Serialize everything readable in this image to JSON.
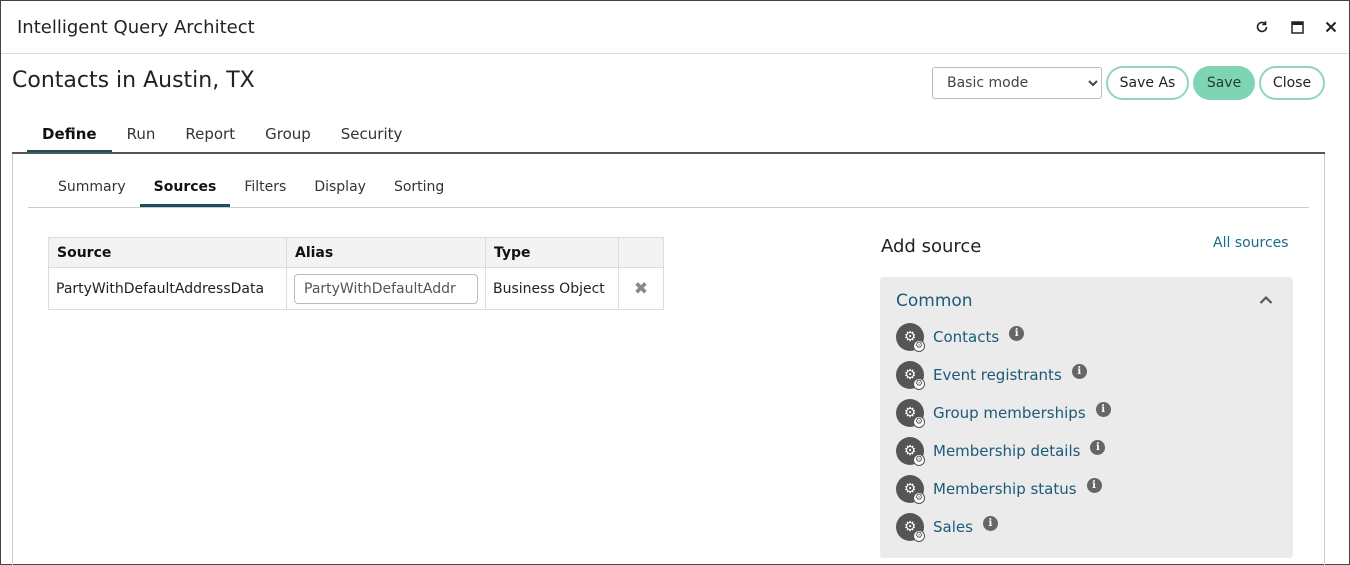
{
  "window": {
    "title": "Intelligent Query Architect",
    "controls": [
      "refresh-icon",
      "maximize-icon",
      "close-icon"
    ]
  },
  "header": {
    "page_title": "Contacts in Austin, TX",
    "mode_select": {
      "value": "Basic mode"
    },
    "save_as_label": "Save As",
    "save_label": "Save",
    "close_label": "Close"
  },
  "main_tabs": [
    {
      "label": "Define",
      "active": true
    },
    {
      "label": "Run"
    },
    {
      "label": "Report"
    },
    {
      "label": "Group"
    },
    {
      "label": "Security"
    }
  ],
  "sub_tabs": [
    {
      "label": "Summary"
    },
    {
      "label": "Sources",
      "active": true
    },
    {
      "label": "Filters"
    },
    {
      "label": "Display"
    },
    {
      "label": "Sorting"
    }
  ],
  "sources_table": {
    "columns": [
      "Source",
      "Alias",
      "Type",
      ""
    ],
    "rows": [
      {
        "source": "PartyWithDefaultAddressData",
        "alias": "PartyWithDefaultAddr",
        "type": "Business Object"
      }
    ]
  },
  "add_source": {
    "title": "Add source",
    "all_sources_label": "All sources",
    "common": {
      "heading": "Common",
      "items": [
        "Contacts",
        "Event registrants",
        "Group memberships",
        "Membership details",
        "Membership status",
        "Sales"
      ]
    }
  },
  "colors": {
    "accent_dark": "#1b4f5e",
    "link": "#1b5a78",
    "primary_button": "#7fd5b3",
    "button_border": "#8fd6bb",
    "panel_bg": "#ebebeb"
  }
}
